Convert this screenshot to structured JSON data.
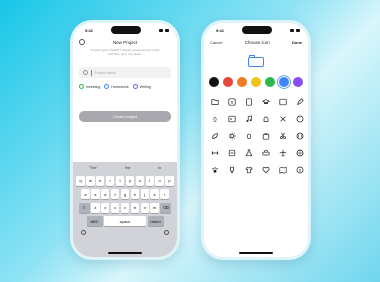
{
  "left_phone": {
    "status_time": "9:41",
    "title": "New Project",
    "subtitle": "Projects give ChatGPT shared context across chats and files, all in one place.",
    "input_placeholder": "Project name",
    "chips": [
      {
        "label": "Investing",
        "icon": "investing-icon",
        "color": "#2db84b"
      },
      {
        "label": "Homework",
        "icon": "homework-icon",
        "color": "#3f86f4"
      },
      {
        "label": "Writing",
        "icon": "writing-icon",
        "color": "#8a4df0"
      }
    ],
    "create_button": "Create project",
    "keyboard": {
      "suggestions": [
        "\"The\"",
        "the",
        "to"
      ],
      "row1": [
        "q",
        "w",
        "e",
        "r",
        "t",
        "y",
        "u",
        "i",
        "o",
        "p"
      ],
      "row2": [
        "a",
        "s",
        "d",
        "f",
        "g",
        "h",
        "j",
        "k",
        "l"
      ],
      "row3": [
        "z",
        "x",
        "c",
        "v",
        "b",
        "n",
        "m"
      ],
      "shift_icon": "shift-icon",
      "delete_icon": "delete-icon",
      "abc": "ABC",
      "space": "space",
      "return": "return",
      "emoji_icon": "emoji-icon",
      "mic_icon": "microphone-icon"
    }
  },
  "right_phone": {
    "status_time": "9:41",
    "cancel": "Cancel",
    "title": "Choose icon",
    "done": "Done",
    "selected_icon": "folder-icon",
    "colors": [
      "#111111",
      "#e8453c",
      "#f07b25",
      "#f5c21b",
      "#2db84b",
      "#3f86f4",
      "#8a4df0"
    ],
    "selected_color": "#3f86f4",
    "icons": [
      "folder-icon",
      "dollar-icon",
      "book-icon",
      "graduation-cap-icon",
      "code-icon",
      "pencil-icon",
      "braces-icon",
      "terminal-icon",
      "music-note-icon",
      "chef-hat-icon",
      "tools-icon",
      "palette-icon",
      "leaf-icon",
      "gear-icon",
      "bug-icon",
      "bag-icon",
      "scissors-icon",
      "tennis-ball-icon",
      "dumbbell-icon",
      "scale-icon",
      "flask-icon",
      "car-icon",
      "airplane-icon",
      "globe-icon",
      "paw-icon",
      "trophy-icon",
      "shirt-icon",
      "heart-icon",
      "map-icon",
      "dollar-circle-icon"
    ]
  }
}
